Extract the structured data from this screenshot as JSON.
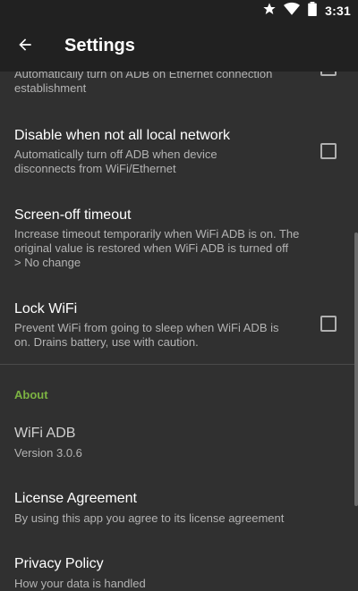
{
  "status_bar": {
    "time": "3:31",
    "icons": [
      "star-icon",
      "wifi-icon",
      "battery-icon"
    ]
  },
  "toolbar": {
    "title": "Settings",
    "back_icon": "arrow-back-icon"
  },
  "preferences": [
    {
      "id": "adb-ethernet",
      "title": "",
      "summary_lines": [
        "Automatically turn on ADB on Ethernet connection",
        "establishment"
      ],
      "checked": false
    },
    {
      "id": "disable-not-local",
      "title": "Disable when not all local network",
      "summary_lines": [
        "Automatically turn off ADB when device",
        "disconnects from WiFi/Ethernet"
      ],
      "checked": false
    },
    {
      "id": "screen-off-timeout",
      "title": "Screen-off timeout",
      "summary_lines": [
        "Increase timeout temporarily when WiFi ADB is on. The",
        "original value is restored when WiFi ADB is turned off",
        "> No change"
      ]
    },
    {
      "id": "lock-wifi",
      "title": "Lock WiFi",
      "summary_lines": [
        "Prevent WiFi from going to sleep when WiFi ADB is",
        "on. Drains battery, use with caution."
      ],
      "checked": false
    }
  ],
  "about": {
    "category_label": "About",
    "app_name": "WiFi ADB",
    "version": "Version 3.0.6",
    "license_title": "License Agreement",
    "license_summary": "By using this app you agree to its license agreement",
    "privacy_title": "Privacy Policy",
    "privacy_summary": "How your data is handled"
  },
  "colors": {
    "background": "#303030",
    "toolbar": "#212121",
    "accent": "#7cb342",
    "text_primary": "#ffffff",
    "text_secondary": "#b3b3b3"
  }
}
